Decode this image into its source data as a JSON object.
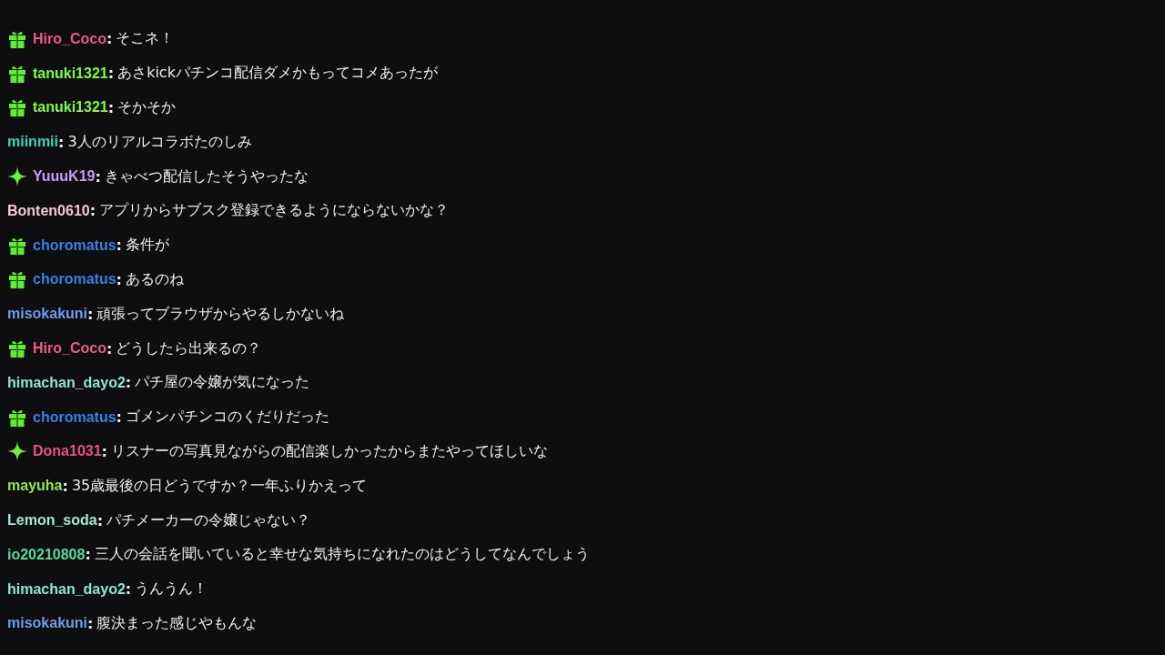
{
  "messages": [
    {
      "user": "Hiro_Coco",
      "separator": ":",
      "color": "#eb5a80",
      "kind": "gift",
      "text": "そこネ！"
    },
    {
      "user": "tanuki1321",
      "separator": ":",
      "color": "#7dfc3c",
      "kind": "gift",
      "text": "あさkickパチンコ配信ダメかもってコメあったが"
    },
    {
      "user": "tanuki1321",
      "separator": ":",
      "color": "#7dfc3c",
      "kind": "gift",
      "text": "そかそか"
    },
    {
      "user": "miinmii",
      "separator": ":",
      "color": "#3cd4b2",
      "kind": "plain",
      "text": "3人のリアルコラボたのしみ"
    },
    {
      "user": "YuuuK19",
      "separator": ":",
      "color": "#c89cff",
      "kind": "sparkle",
      "text": "きゃべつ配信したそうやったな"
    },
    {
      "user": "Bonten0610",
      "separator": ":",
      "color": "#f2c8d0",
      "kind": "plain",
      "text": "アプリからサブスク登録できるようにならないかな？"
    },
    {
      "user": "choromatus",
      "separator": ":",
      "color": "#3b7ee8",
      "kind": "gift",
      "text": "条件が"
    },
    {
      "user": "choromatus",
      "separator": ":",
      "color": "#3b7ee8",
      "kind": "gift",
      "text": "あるのね"
    },
    {
      "user": "misokakuni",
      "separator": ":",
      "color": "#6c9ee8",
      "kind": "plain",
      "text": "頑張ってブラウザからやるしかないね"
    },
    {
      "user": "Hiro_Coco",
      "separator": ":",
      "color": "#eb5a80",
      "kind": "gift",
      "text": "どうしたら出来るの？"
    },
    {
      "user": "himachan_dayo2",
      "separator": ":",
      "color": "#8ae6d2",
      "kind": "plain",
      "text": "パチ屋の令嬢が気になった"
    },
    {
      "user": "choromatus",
      "separator": ":",
      "color": "#3b7ee8",
      "kind": "gift",
      "text": "ゴメンパチンコのくだりだった"
    },
    {
      "user": "Dona1031",
      "separator": ":",
      "color": "#e8527c",
      "kind": "sparkle",
      "text": "リスナーの写真見ながらの配信楽しかったからまたやってほしいな"
    },
    {
      "user": "mayuha",
      "separator": ":",
      "color": "#8ee84c",
      "kind": "plain",
      "text": "35歳最後の日どうですか？一年ふりかえって"
    },
    {
      "user": "Lemon_soda",
      "separator": ":",
      "color": "#a0ead4",
      "kind": "plain",
      "text": "パチメーカーの令嬢じゃない？"
    },
    {
      "user": "io20210808",
      "separator": ":",
      "color": "#50dc9c",
      "kind": "plain",
      "text": "三人の会話を聞いていると幸せな気持ちになれたのはどうしてなんでしょう"
    },
    {
      "user": "himachan_dayo2",
      "separator": ":",
      "color": "#8ae6d2",
      "kind": "plain",
      "text": "うんうん！"
    },
    {
      "user": "misokakuni",
      "separator": ":",
      "color": "#6c9ee8",
      "kind": "plain",
      "text": "腹決まった感じやもんな"
    }
  ]
}
